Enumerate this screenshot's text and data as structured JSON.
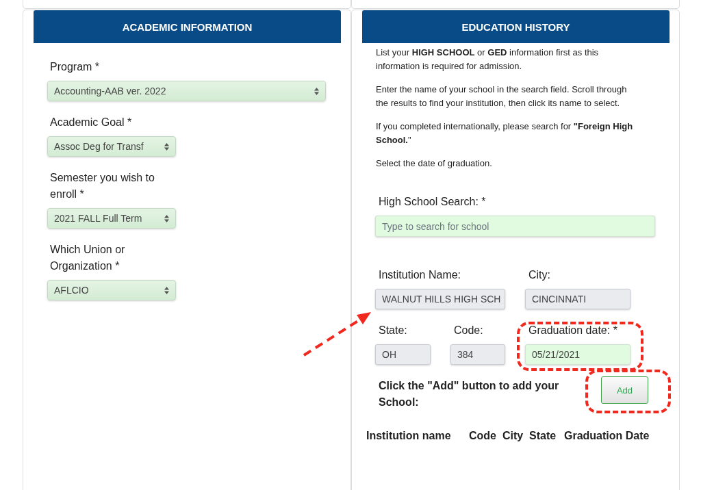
{
  "academic_information": {
    "title": "ACADEMIC INFORMATION",
    "program": {
      "label": "Program *",
      "value": "Accounting-AAB ver. 2022"
    },
    "fields": [
      {
        "label": "Academic Goal *",
        "value": "Assoc Deg for Transf"
      },
      {
        "label": "Semester you wish to enroll *",
        "value": "2021 FALL Full Term"
      },
      {
        "label": "Which Union or Organization *",
        "value": "AFLCIO"
      }
    ]
  },
  "education_history": {
    "title": "EDUCATION HISTORY",
    "instructions": [
      "List your **HIGH SCHOOL** or **GED** information first as this information is required for admission.",
      "Enter the name of your school in the search field. Scroll through the results to find your institution, then click its name to select.",
      "If you completed internationally, please search for **\"Foreign High School.**\"",
      "Select the date of graduation."
    ],
    "high_school_search": {
      "label": "High School Search: *",
      "placeholder": "Type to search for school"
    },
    "school_fields": [
      {
        "label": "Institution Name:",
        "value": "WALNUT HILLS HIGH SCH",
        "readonly": true,
        "highlighted": false,
        "pointed_at": true
      },
      {
        "label": "City:",
        "value": "CINCINNATI",
        "readonly": true,
        "highlighted": false,
        "pointed_at": false
      },
      {
        "label": "State:",
        "value": "OH",
        "readonly": true,
        "highlighted": false,
        "pointed_at": false
      },
      {
        "label": "Code:",
        "value": "384",
        "readonly": true,
        "highlighted": false,
        "pointed_at": false
      },
      {
        "label": "Graduation date: *",
        "value": "05/21/2021",
        "readonly": false,
        "highlighted": true,
        "pointed_at": false
      }
    ],
    "add_prompt": "Click the \"Add\" button to add your School:",
    "add_button": {
      "label": "Add",
      "highlighted": true
    },
    "table": {
      "columns": [
        "Institution name",
        "Code",
        "City",
        "State",
        "Graduation Date"
      ]
    }
  }
}
